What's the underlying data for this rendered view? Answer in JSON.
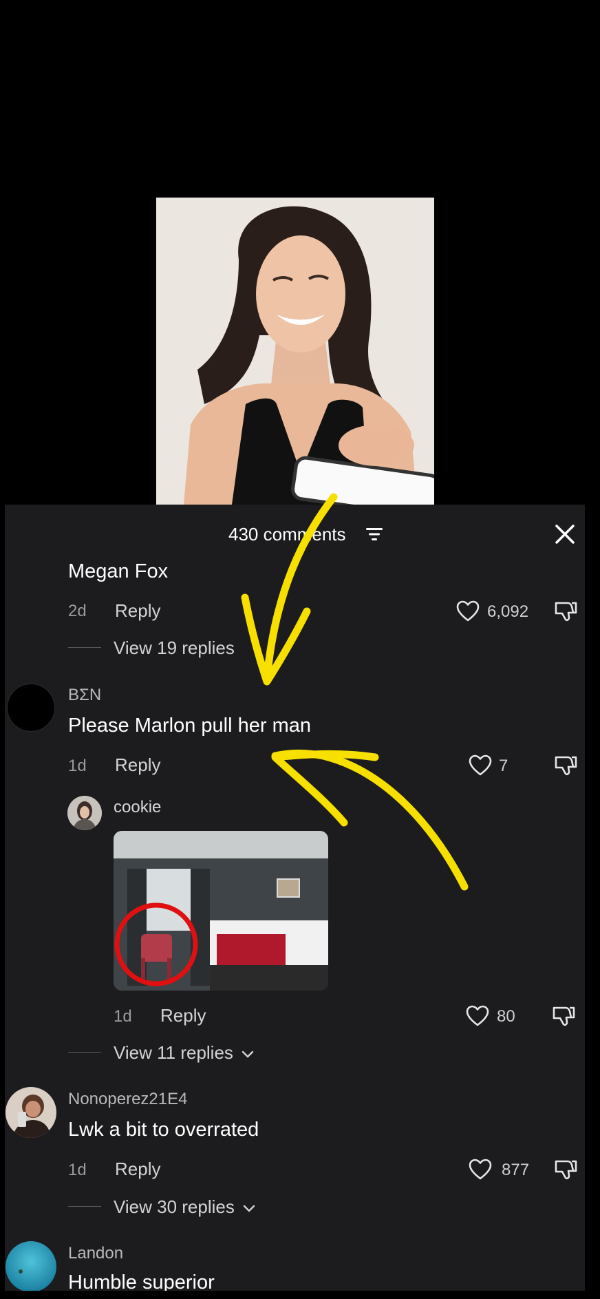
{
  "sheet": {
    "comment_count": "430 comments",
    "icons": {
      "sort": "sort-filter-icon",
      "close": "close-icon",
      "like": "heart-icon",
      "dislike": "thumbs-down-icon"
    }
  },
  "comments": [
    {
      "author": "",
      "text": "Megan Fox",
      "time": "2d",
      "reply_label": "Reply",
      "likes": "6,092",
      "view_replies": "View 19 replies"
    },
    {
      "author": "BΣN",
      "text": "Please Marlon pull her man",
      "time": "1d",
      "reply_label": "Reply",
      "likes": "7",
      "reply": {
        "author": "cookie",
        "time": "1d",
        "reply_label": "Reply",
        "likes": "80"
      },
      "view_replies": "View 11 replies"
    },
    {
      "author": "Nonoperez21E4",
      "text": "Lwk a bit to overrated",
      "time": "1d",
      "reply_label": "Reply",
      "likes": "877",
      "view_replies": "View 30 replies"
    },
    {
      "author": "Landon",
      "text": "Humble superior"
    }
  ],
  "colors": {
    "sheet_bg": "#1c1c1e",
    "annotation_arrow": "#f7e000",
    "annotation_circle": "#e01010"
  }
}
